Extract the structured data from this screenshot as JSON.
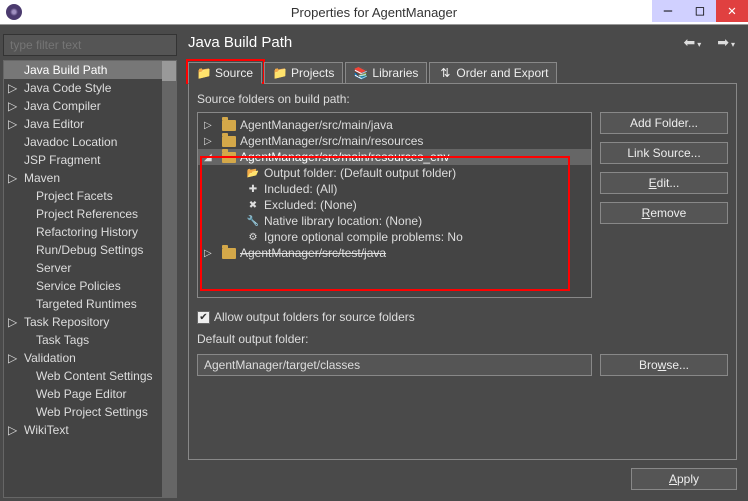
{
  "window": {
    "title": "Properties for AgentManager"
  },
  "filter": {
    "placeholder": "type filter text"
  },
  "tree": {
    "items": [
      {
        "label": "Java Build Path",
        "expandable": false,
        "selected": true
      },
      {
        "label": "Java Code Style",
        "expandable": true
      },
      {
        "label": "Java Compiler",
        "expandable": true
      },
      {
        "label": "Java Editor",
        "expandable": true
      },
      {
        "label": "Javadoc Location",
        "expandable": false
      },
      {
        "label": "JSP Fragment",
        "expandable": false
      },
      {
        "label": "Maven",
        "expandable": true
      },
      {
        "label": "Project Facets",
        "expandable": false,
        "child": true
      },
      {
        "label": "Project References",
        "expandable": false,
        "child": true
      },
      {
        "label": "Refactoring History",
        "expandable": false,
        "child": true
      },
      {
        "label": "Run/Debug Settings",
        "expandable": false,
        "child": true
      },
      {
        "label": "Server",
        "expandable": false,
        "child": true
      },
      {
        "label": "Service Policies",
        "expandable": false,
        "child": true
      },
      {
        "label": "Targeted Runtimes",
        "expandable": false,
        "child": true
      },
      {
        "label": "Task Repository",
        "expandable": true
      },
      {
        "label": "Task Tags",
        "expandable": false,
        "child": true
      },
      {
        "label": "Validation",
        "expandable": true
      },
      {
        "label": "Web Content Settings",
        "expandable": false,
        "child": true
      },
      {
        "label": "Web Page Editor",
        "expandable": false,
        "child": true
      },
      {
        "label": "Web Project Settings",
        "expandable": false,
        "child": true
      },
      {
        "label": "WikiText",
        "expandable": true
      }
    ]
  },
  "page": {
    "title": "Java Build Path",
    "tabs": [
      {
        "label": "Source",
        "active": true
      },
      {
        "label": "Projects",
        "active": false
      },
      {
        "label": "Libraries",
        "active": false
      },
      {
        "label": "Order and Export",
        "active": false
      }
    ],
    "source_folders_label": "Source folders on build path:",
    "buttons": {
      "add_folder": "Add Folder...",
      "link_source": "Link Source...",
      "edit": "Edit...",
      "remove": "Remove"
    },
    "source_tree": [
      {
        "label": "AgentManager/src/main/java",
        "expand": "▷",
        "level": 0
      },
      {
        "label": "AgentManager/src/main/resources",
        "expand": "▷",
        "level": 0
      },
      {
        "label": "AgentManager/src/main/resources_env",
        "expand": "◢",
        "level": 0,
        "selected": true
      },
      {
        "label": "Output folder: (Default output folder)",
        "level": 1,
        "icon": "output"
      },
      {
        "label": "Included: (All)",
        "level": 1,
        "icon": "incl"
      },
      {
        "label": "Excluded: (None)",
        "level": 1,
        "icon": "excl"
      },
      {
        "label": "Native library location: (None)",
        "level": 1,
        "icon": "native"
      },
      {
        "label": "Ignore optional compile problems: No",
        "level": 1,
        "icon": "ignore"
      },
      {
        "label": "AgentManager/src/test/java",
        "expand": "▷",
        "level": 0,
        "strike": true
      }
    ],
    "allow_output_label": "Allow output folders for source folders",
    "allow_output_checked": true,
    "default_output_label": "Default output folder:",
    "default_output_value": "AgentManager/target/classes",
    "browse": "Browse...",
    "apply": "Apply"
  }
}
